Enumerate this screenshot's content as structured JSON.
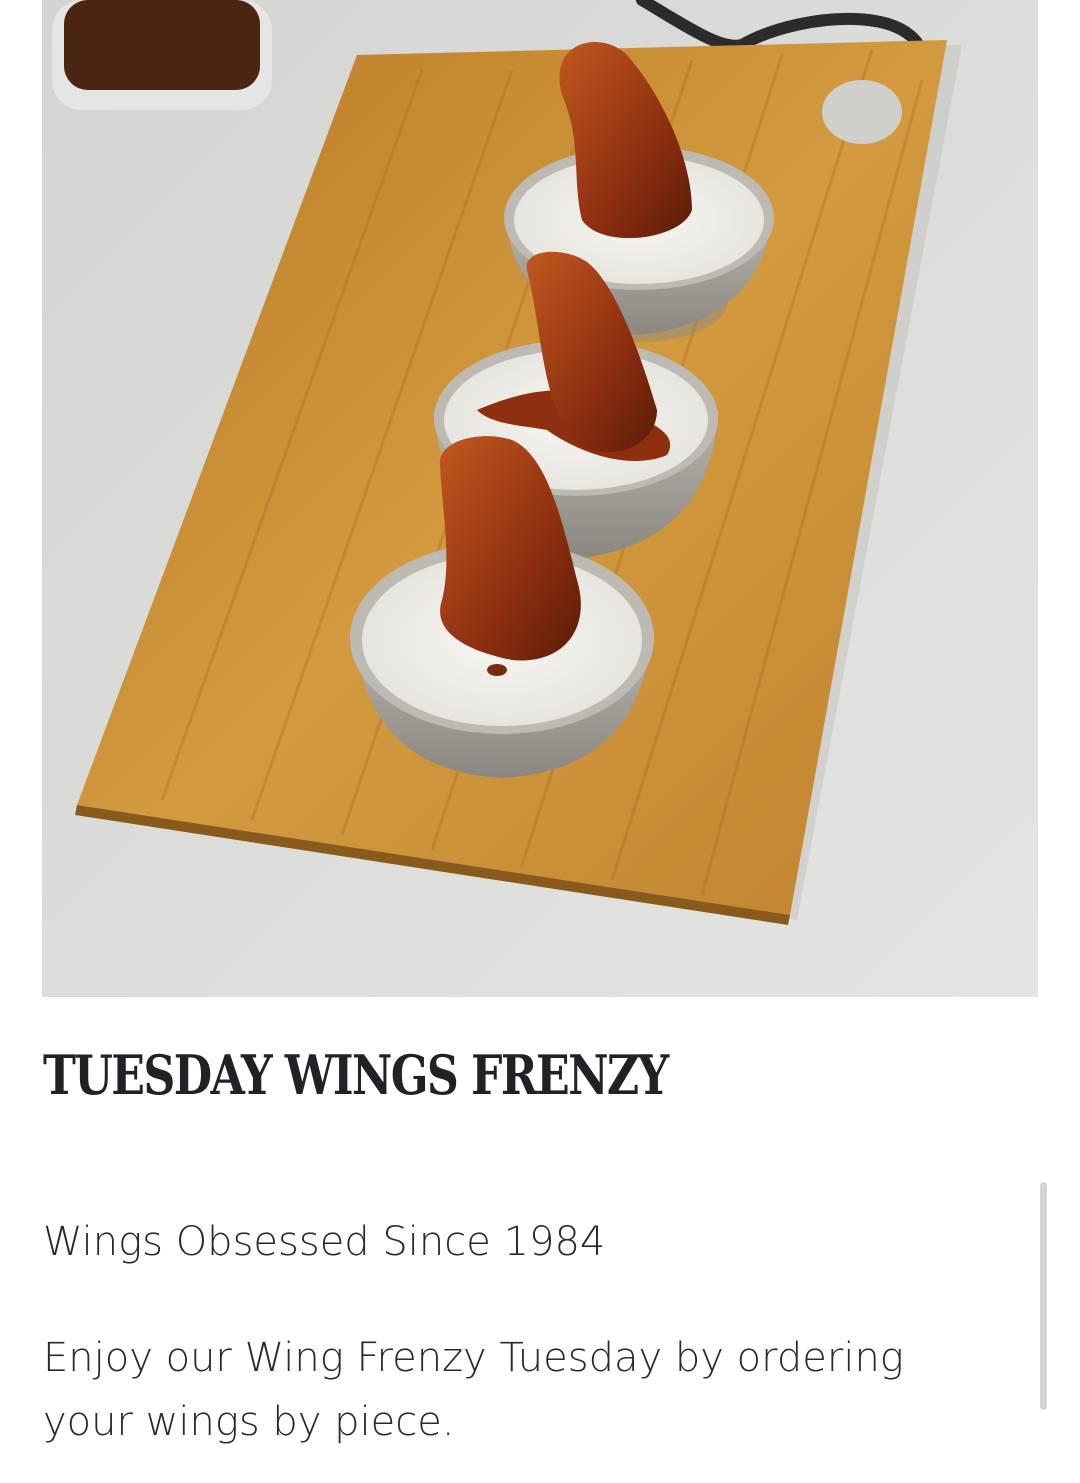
{
  "promo": {
    "image_subject": "Three saucy chicken wings dipped in cups of ranch on a wooden board",
    "title": "TUESDAY WINGS FRENZY",
    "tagline": "Wings Obsessed Since 1984",
    "description": "Enjoy our Wing Frenzy Tuesday by ordering your wings by piece."
  },
  "colors": {
    "title": "#1f2328",
    "text": "#2a2a2a",
    "board": "#c8892e",
    "sauce": "#9a3a14",
    "ranch": "#f1efe9",
    "background": "#ffffff"
  }
}
